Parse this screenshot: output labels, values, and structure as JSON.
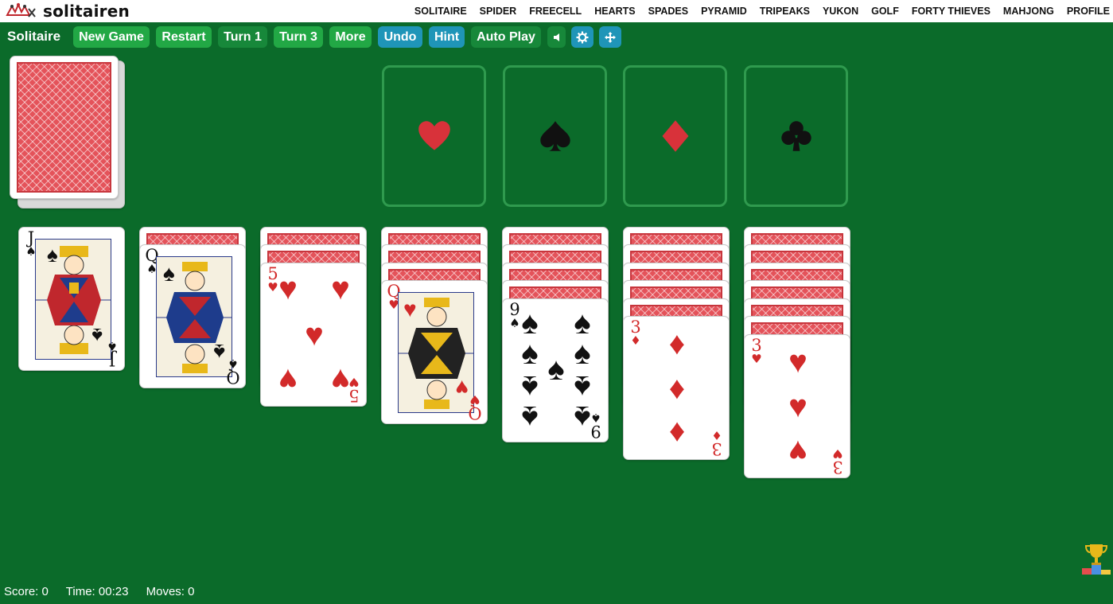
{
  "brand": {
    "name": "solitairen"
  },
  "nav": [
    "SOLITAIRE",
    "SPIDER",
    "FREECELL",
    "HEARTS",
    "SPADES",
    "PYRAMID",
    "TRIPEAKS",
    "YUKON",
    "GOLF",
    "FORTY THIEVES",
    "MAHJONG",
    "PROFILE"
  ],
  "toolbar": {
    "title": "Solitaire",
    "new_game": "New Game",
    "restart": "Restart",
    "turn1": "Turn 1",
    "turn3": "Turn 3",
    "more": "More",
    "undo": "Undo",
    "hint": "Hint",
    "auto_play": "Auto Play"
  },
  "icons": {
    "sound": "speaker-icon",
    "settings": "gear-icon",
    "move": "move-arrows-icon",
    "trophy": "trophy-icon"
  },
  "colors": {
    "felt": "#0b6b2a",
    "green_button": "#22a845",
    "blue_button": "#1f95b8",
    "red_suit": "#d22a2a"
  },
  "foundations": [
    {
      "suit": "hearts",
      "symbol": "♥"
    },
    {
      "suit": "spades",
      "symbol": "♠"
    },
    {
      "suit": "diamonds",
      "symbol": "♦"
    },
    {
      "suit": "clubs",
      "symbol": "♣"
    }
  ],
  "tableau": [
    {
      "hidden": 0,
      "card": {
        "rank": "J",
        "suit": "♠",
        "color": "black",
        "face": true
      }
    },
    {
      "hidden": 1,
      "card": {
        "rank": "Q",
        "suit": "♠",
        "color": "black",
        "face": true
      }
    },
    {
      "hidden": 2,
      "card": {
        "rank": "5",
        "suit": "♥",
        "color": "red",
        "face": false
      }
    },
    {
      "hidden": 3,
      "card": {
        "rank": "Q",
        "suit": "♥",
        "color": "red",
        "face": true
      }
    },
    {
      "hidden": 4,
      "card": {
        "rank": "9",
        "suit": "♠",
        "color": "black",
        "face": false
      }
    },
    {
      "hidden": 5,
      "card": {
        "rank": "3",
        "suit": "♦",
        "color": "red",
        "face": false
      }
    },
    {
      "hidden": 6,
      "card": {
        "rank": "3",
        "suit": "♥",
        "color": "red",
        "face": false
      }
    }
  ],
  "status": {
    "score": "Score: 0",
    "time": "Time: 00:23",
    "moves": "Moves: 0"
  }
}
